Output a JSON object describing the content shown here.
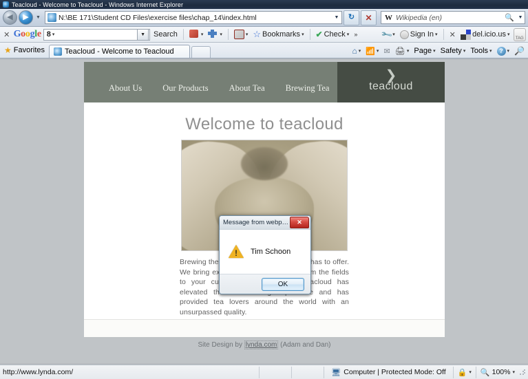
{
  "window": {
    "title": "Teacloud - Welcome to Teacloud - Windows Internet Explorer"
  },
  "navbar": {
    "back_label": "◀",
    "forward_label": "▶",
    "dropdown_caret": "▼",
    "address_value": "N:\\BE 171\\Student CD Files\\exercise files\\chap_14\\index.html",
    "address_caret": "▼",
    "refresh_label": "↻",
    "stop_label": "✕",
    "search_engine": "W",
    "search_placeholder": "Wikipedia (en)",
    "search_icon": "🔍",
    "search_caret": "▼"
  },
  "google_toolbar": {
    "close_label": "✕",
    "logo": {
      "g1": "G",
      "o1": "o",
      "o2": "o",
      "g2": "g",
      "l": "l",
      "e": "e"
    },
    "search_value": "",
    "search_prefix": "8",
    "search_prefix_caret": "▾",
    "dropdown_caret": "▼",
    "search_label": "Search",
    "items": [
      {
        "label": "",
        "icon": "translate-icon",
        "caret": "▾"
      },
      {
        "label": "",
        "icon": "plus-icon",
        "caret": "▾"
      },
      {
        "label": "",
        "icon": "popup-blocker-icon",
        "caret": "▾"
      },
      {
        "label": "Bookmarks",
        "icon": "bookmark-star-icon",
        "caret": "▾"
      },
      {
        "label": "Check",
        "icon": "spellcheck-icon",
        "caret": "▾"
      },
      {
        "label": "",
        "icon": "chevron-double-icon",
        "caret": ""
      },
      {
        "label": "",
        "icon": "wrench-icon",
        "caret": "▾"
      },
      {
        "label": "Sign In",
        "icon": "signin-icon",
        "caret": "▾"
      }
    ],
    "delicious_close": "✕",
    "delicious_label": "del.icio.us",
    "delicious_caret": "▾",
    "tag_label": "TAG"
  },
  "tabbar": {
    "favorites_label": "Favorites",
    "favorites_icon": "star-icon",
    "tab_label": "Teacloud - Welcome to Teacloud",
    "new_tab_label": "",
    "commands": [
      {
        "label": "",
        "icon": "home-icon",
        "caret": "▾"
      },
      {
        "label": "",
        "icon": "feed-icon",
        "caret": "▾"
      },
      {
        "label": "",
        "icon": "mail-icon",
        "caret": ""
      },
      {
        "label": "",
        "icon": "print-icon",
        "caret": "▾"
      },
      {
        "label": "Page",
        "icon": "",
        "caret": "▾"
      },
      {
        "label": "Safety",
        "icon": "",
        "caret": "▾"
      },
      {
        "label": "Tools",
        "icon": "",
        "caret": "▾"
      },
      {
        "label": "",
        "icon": "help-icon",
        "caret": "▾"
      },
      {
        "label": "",
        "icon": "research-icon",
        "caret": ""
      }
    ]
  },
  "site": {
    "nav_links": [
      "About Us",
      "Our Products",
      "About Tea",
      "Brewing Tea"
    ],
    "logo_swirl": "❯",
    "logo_text": "teacloud",
    "heading": "Welcome to teacloud",
    "image_alt": "hands-holding-tea-leaves-photo",
    "paragraph": "Brewing the finest loose leaf tea nature has to offer. We bring exotic and tantalizing teas from the fields to your cup. For over 15 years teacloud has elevated the tea drinking experience and has provided tea lovers around the world with an unsurpassed quality.",
    "footer_prefix": "Site Design by ",
    "footer_link": "lynda.com",
    "footer_suffix": " (Adam and Dan)",
    "nav_bg": "#767f75",
    "logo_bg": "#454c44"
  },
  "dialog": {
    "title": "Message from webpa...",
    "close_label": "✕",
    "icon": "warning-icon",
    "warning_glyph": "!",
    "message": "Tim Schoon",
    "ok_label": "OK"
  },
  "statusbar": {
    "url": "http://www.lynda.com/",
    "zone": "Computer | Protected Mode: Off",
    "zone_icon": "computer-icon",
    "lock_icon": "protected-mode-icon",
    "lock_caret": "▾",
    "zoom_icon": "zoom-icon",
    "zoom_level": "100%",
    "zoom_caret": "▾"
  }
}
